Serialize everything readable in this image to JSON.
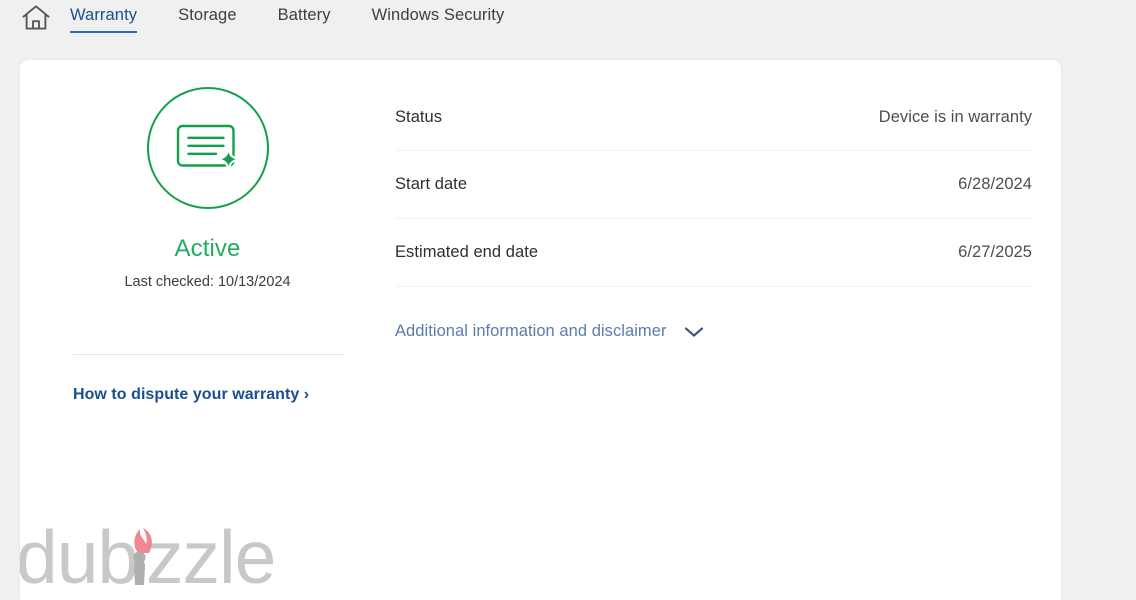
{
  "nav": {
    "home_icon": "home-icon",
    "tabs": [
      {
        "label": "Warranty",
        "active": true
      },
      {
        "label": "Storage",
        "active": false
      },
      {
        "label": "Battery",
        "active": false
      },
      {
        "label": "Windows Security",
        "active": false
      }
    ]
  },
  "warranty": {
    "status_icon": "warranty-card-sparkle-icon",
    "status_title": "Active",
    "status_title_color": "#21ac5e",
    "status_ring_color": "#13a04c",
    "last_checked": "Last checked: 10/13/2024",
    "dispute_link": "How to dispute your warranty ›",
    "details": [
      {
        "label": "Status",
        "value": "Device is in warranty"
      },
      {
        "label": "Start date",
        "value": "6/28/2024"
      },
      {
        "label": "Estimated end date",
        "value": "6/27/2025"
      }
    ],
    "disclosure": {
      "label": "Additional information and disclaimer",
      "icon": "chevron-down-icon",
      "expanded": false
    }
  },
  "watermark": {
    "text": "dubizzle",
    "text_color": "#bdbdbd",
    "flame_color": "#ef6f7a"
  }
}
